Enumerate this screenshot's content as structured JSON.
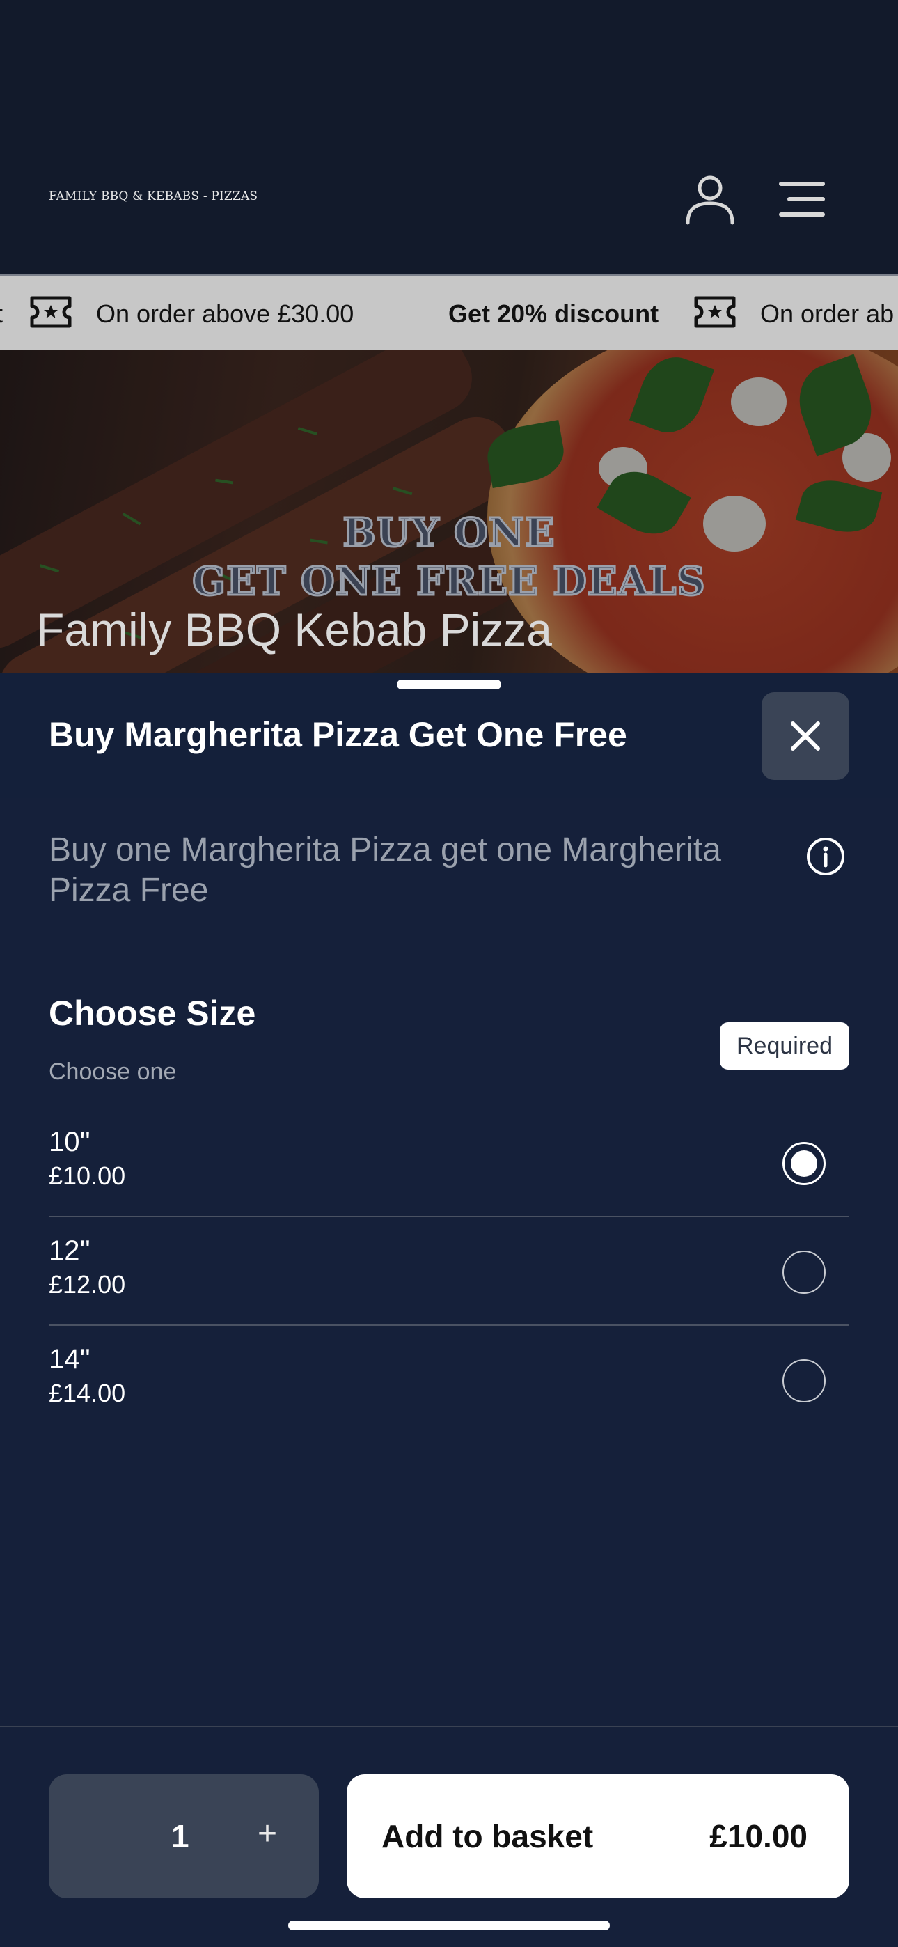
{
  "header": {
    "logo_text": "FAMILY BBQ & KEBABS - PIZZAS"
  },
  "ticker": {
    "item_1_tail": "t",
    "item_1_offer": "On order above £30.00",
    "item_2_title": "Get 20% discount",
    "item_2_offer": "On order ab"
  },
  "hero": {
    "deal_line_1": "BUY ONE",
    "deal_line_2": "GET ONE FREE DEALS",
    "restaurant_name": "Family BBQ Kebab Pizza"
  },
  "sheet": {
    "title": "Buy Margherita Pizza Get One Free",
    "description": "Buy one Margherita Pizza get one Margherita Pizza Free",
    "section": {
      "title": "Choose Size",
      "subtitle": "Choose one",
      "required_label": "Required"
    },
    "options": [
      {
        "size": "10''",
        "price": "£10.00",
        "selected": true
      },
      {
        "size": "12''",
        "price": "£12.00",
        "selected": false
      },
      {
        "size": "14''",
        "price": "£14.00",
        "selected": false
      }
    ]
  },
  "footer": {
    "quantity": "1",
    "plus_label": "+",
    "add_label": "Add to basket",
    "total_price": "£10.00"
  },
  "colors": {
    "background": "#121a2b",
    "sheet": "#15203a",
    "ticker": "#c7c7c7",
    "button_dark": "#3a4456",
    "button_light": "#ffffff"
  },
  "icons": [
    "account-icon",
    "menu-icon",
    "ticket-icon",
    "close-icon",
    "info-icon"
  ]
}
